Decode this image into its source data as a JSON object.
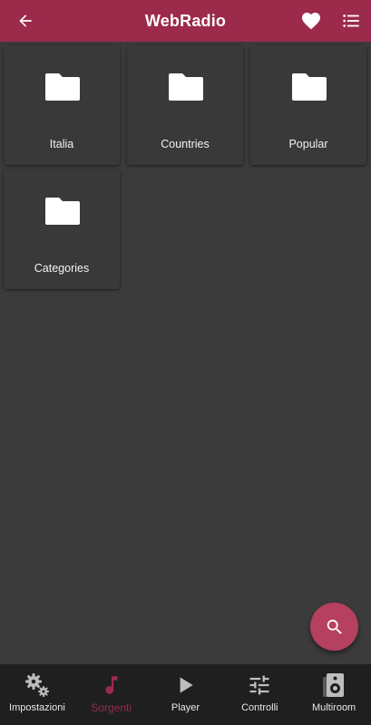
{
  "app_bar": {
    "title": "WebRadio",
    "back_icon": "arrow-back-icon",
    "favorite_icon": "heart-icon",
    "list_icon": "list-icon"
  },
  "folders": [
    {
      "label": "Italia",
      "icon": "folder-icon"
    },
    {
      "label": "Countries",
      "icon": "folder-icon"
    },
    {
      "label": "Popular",
      "icon": "folder-icon"
    },
    {
      "label": "Categories",
      "icon": "folder-icon"
    }
  ],
  "fab": {
    "icon": "search-icon"
  },
  "bottom_nav": {
    "items": [
      {
        "label": "Impostazioni",
        "icon": "gears-icon",
        "active": false
      },
      {
        "label": "Sorgenti",
        "icon": "music-note-icon",
        "active": true
      },
      {
        "label": "Player",
        "icon": "play-icon",
        "active": false
      },
      {
        "label": "Controlli",
        "icon": "sliders-icon",
        "active": false
      },
      {
        "label": "Multiroom",
        "icon": "speaker-icon",
        "active": false
      }
    ]
  },
  "colors": {
    "accent": "#9c2a4b",
    "fab": "#b5405f",
    "background": "#3b3b3b",
    "bottom_nav": "#1f1f1f"
  }
}
